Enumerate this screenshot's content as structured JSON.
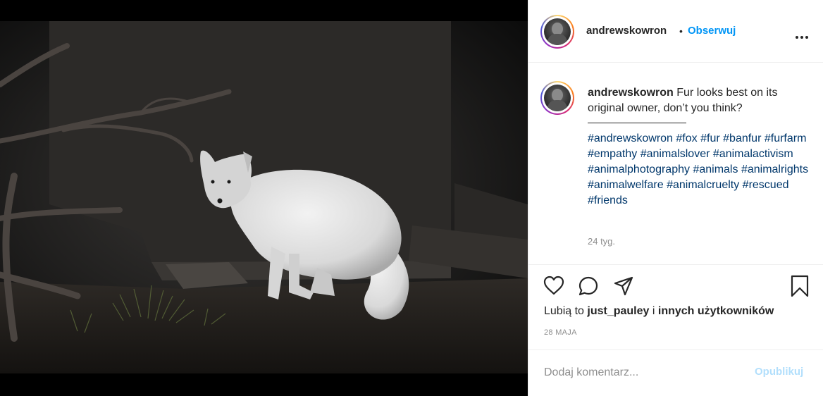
{
  "post": {
    "image_alt": "white arctic fox",
    "author": "andrewskowron",
    "follow_label": "Obserwuj",
    "separator": "•"
  },
  "caption": {
    "username": "andrewskowron",
    "text": "Fur looks best on its original owner, don’t you think?",
    "hashtags": [
      "#andrewskowron",
      "#fox",
      "#fur",
      "#banfur",
      "#furfarm",
      "#empathy",
      "#animalslover",
      "#animalactivism",
      "#animalphotography",
      "#animals",
      "#animalrights",
      "#animalwelfare",
      "#animalcruelty",
      "#rescued",
      "#friends"
    ],
    "time_ago": "24 tyg."
  },
  "engagement": {
    "likes_prefix": "Lubią to",
    "liked_by": "just_pauley",
    "likes_middle": "i",
    "likes_others": "innych użytkowników",
    "date": "28 MAJA"
  },
  "comment_box": {
    "placeholder": "Dodaj komentarz...",
    "publish_label": "Opublikuj"
  },
  "colors": {
    "follow": "#0095f6",
    "hashtag": "#00376b",
    "publish_disabled": "#b2dffc",
    "muted": "#8e8e8e"
  },
  "icons": [
    "more-options-icon",
    "heart-icon",
    "comment-icon",
    "share-icon",
    "bookmark-icon"
  ]
}
